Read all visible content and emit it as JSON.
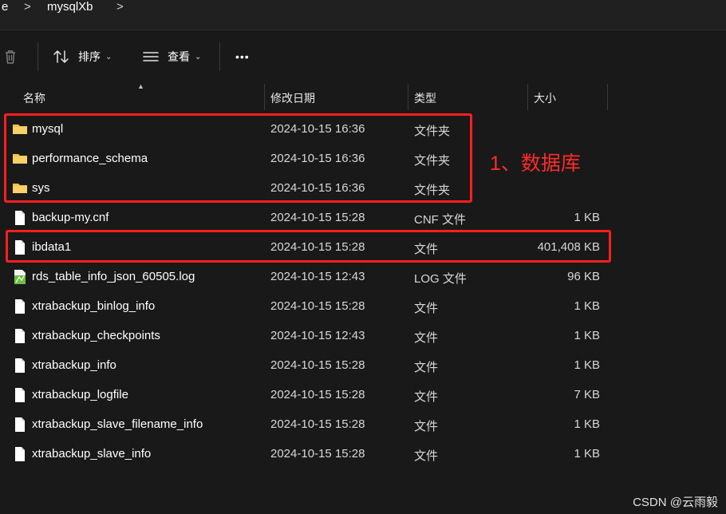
{
  "breadcrumb": {
    "items": [
      "e",
      "mysqlXb"
    ],
    "separator": ">"
  },
  "toolbar": {
    "sort_label": "排序",
    "view_label": "查看",
    "more_label": "•••"
  },
  "columns": {
    "name": "名称",
    "modified": "修改日期",
    "type": "类型",
    "size": "大小"
  },
  "files": [
    {
      "icon": "folder-icon",
      "name": "mysql",
      "modified": "2024-10-15 16:36",
      "type": "文件夹",
      "size": ""
    },
    {
      "icon": "folder-icon",
      "name": "performance_schema",
      "modified": "2024-10-15 16:36",
      "type": "文件夹",
      "size": ""
    },
    {
      "icon": "folder-icon",
      "name": "sys",
      "modified": "2024-10-15 16:36",
      "type": "文件夹",
      "size": ""
    },
    {
      "icon": "file-icon",
      "name": "backup-my.cnf",
      "modified": "2024-10-15 15:28",
      "type": "CNF 文件",
      "size": "1 KB"
    },
    {
      "icon": "file-icon",
      "name": "ibdata1",
      "modified": "2024-10-15 15:28",
      "type": "文件",
      "size": "401,408 KB"
    },
    {
      "icon": "log-file-icon",
      "name": "rds_table_info_json_60505.log",
      "modified": "2024-10-15 12:43",
      "type": "LOG 文件",
      "size": "96 KB"
    },
    {
      "icon": "file-icon",
      "name": "xtrabackup_binlog_info",
      "modified": "2024-10-15 15:28",
      "type": "文件",
      "size": "1 KB"
    },
    {
      "icon": "file-icon",
      "name": "xtrabackup_checkpoints",
      "modified": "2024-10-15 12:43",
      "type": "文件",
      "size": "1 KB"
    },
    {
      "icon": "file-icon",
      "name": "xtrabackup_info",
      "modified": "2024-10-15 15:28",
      "type": "文件",
      "size": "1 KB"
    },
    {
      "icon": "file-icon",
      "name": "xtrabackup_logfile",
      "modified": "2024-10-15 15:28",
      "type": "文件",
      "size": "7 KB"
    },
    {
      "icon": "file-icon",
      "name": "xtrabackup_slave_filename_info",
      "modified": "2024-10-15 15:28",
      "type": "文件",
      "size": "1 KB"
    },
    {
      "icon": "file-icon",
      "name": "xtrabackup_slave_info",
      "modified": "2024-10-15 15:28",
      "type": "文件",
      "size": "1 KB"
    }
  ],
  "annotation": {
    "text": "1、数据库",
    "color": "#ff1f1f"
  },
  "watermark": "CSDN @云雨毅",
  "colors": {
    "background": "#191919",
    "folder": "#f2c14e",
    "highlight": "#ff1f1f"
  }
}
